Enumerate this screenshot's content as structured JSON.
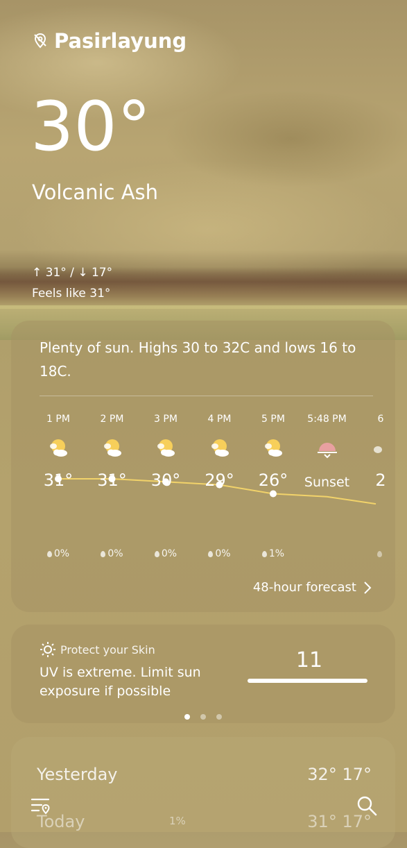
{
  "location": {
    "name": "Pasirlayung",
    "icon": "location-off-icon"
  },
  "current": {
    "temperature": "30°",
    "condition": "Volcanic Ash",
    "high_low": "↑ 31° / ↓ 17°",
    "feels_like": "Feels like 31°"
  },
  "summary": "Plenty of sun. Highs 30 to 32C and lows 16 to 18C.",
  "hourly": [
    {
      "time": "1 PM",
      "temp": "31°",
      "rain": "0%",
      "icon": "sun-cloud-icon"
    },
    {
      "time": "2 PM",
      "temp": "31°",
      "rain": "0%",
      "icon": "sun-cloud-icon"
    },
    {
      "time": "3 PM",
      "temp": "30°",
      "rain": "0%",
      "icon": "sun-cloud-icon"
    },
    {
      "time": "4 PM",
      "temp": "29°",
      "rain": "0%",
      "icon": "sun-cloud-icon"
    },
    {
      "time": "5 PM",
      "temp": "26°",
      "rain": "1%",
      "icon": "sun-cloud-icon"
    },
    {
      "time": "5:48 PM",
      "temp": "Sunset",
      "rain": "",
      "icon": "sunset-icon"
    },
    {
      "time": "6",
      "temp": "2",
      "rain": "",
      "icon": "moon-cloud-icon"
    }
  ],
  "hourly_temps": [
    31,
    31,
    30,
    29,
    26,
    25,
    24
  ],
  "forecast_link": "48-hour forecast",
  "uv": {
    "header": "Protect your Skin",
    "message": "UV is extreme. Limit sun exposure if possible",
    "index": "11"
  },
  "daily": {
    "yesterday": {
      "label": "Yesterday",
      "temps": "32°  17°"
    },
    "today": {
      "label": "Today",
      "rain": "1%",
      "temps": "31°  17°"
    }
  },
  "colors": {
    "accent_line": "#f2d36a",
    "sunset": "#e8a0a0",
    "sun": "#f7cf5a"
  }
}
